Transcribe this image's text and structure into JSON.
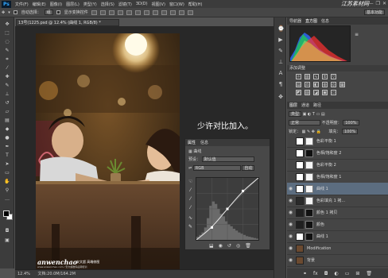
{
  "app": {
    "logo": "Ps",
    "watermark": "江苏素材网"
  },
  "menu": [
    "文件(F)",
    "编辑(E)",
    "图像(I)",
    "图层(L)",
    "类型(Y)",
    "选择(S)",
    "滤镜(T)",
    "3D(D)",
    "视图(V)",
    "窗口(W)",
    "帮助(H)"
  ],
  "window_controls": [
    "—",
    "❐",
    "✕"
  ],
  "options_bar": {
    "auto_select_label": "自动选择：",
    "auto_select_value": "组",
    "show_transform_label": "显示变换控件",
    "workspace": "基本功能"
  },
  "document": {
    "tab_title": "13号(1225.psd @ 12.4% (曲线 1, RGB/8) *",
    "caption": "少许对比加入。",
    "watermark_brand": "anwenchao",
    "watermark_cn": "安文超 高端修图",
    "watermark_sub": "www.anwenchao.com / 安文超数码后期培训"
  },
  "status_bar": {
    "zoom": "12.4%",
    "doc_info": "文档:20.0M/164.2M"
  },
  "curves_panel": {
    "tabs": [
      "属性",
      "信息"
    ],
    "title": "曲线",
    "preset_label": "预设：",
    "preset_value": "默认值",
    "channel_value": "RGB",
    "auto_button": "自动",
    "curve_points": [
      [
        0,
        0
      ],
      [
        0.25,
        0.2
      ],
      [
        0.5,
        0.5
      ],
      [
        0.75,
        0.79
      ],
      [
        1,
        1
      ]
    ],
    "histogram": [
      0.05,
      0.08,
      0.12,
      0.2,
      0.35,
      0.55,
      0.62,
      0.58,
      0.5,
      0.42,
      0.38,
      0.3,
      0.25,
      0.22,
      0.18,
      0.15,
      0.12,
      0.1,
      0.08,
      0.06,
      0.05,
      0.04,
      0.03,
      0.02
    ]
  },
  "histogram_panel": {
    "tabs": [
      "导航器",
      "直方图",
      "信息"
    ]
  },
  "adjustments_panel": {
    "title": "添加调整"
  },
  "layers_panel": {
    "tabs": [
      "图层",
      "通道",
      "路径"
    ],
    "kind_label": "类型",
    "blend_mode": "正常",
    "opacity_label": "不透明度：",
    "opacity_value": "100%",
    "lock_label": "锁定：",
    "fill_label": "填充：",
    "fill_value": "100%",
    "layers": [
      {
        "name": "色彩平衡 1",
        "thumb": "#ffffff",
        "mask": "#f4f4f4",
        "visible": false,
        "selected": false
      },
      {
        "name": "色相/饱和度 2",
        "thumb": "#ffffff",
        "mask": "#111111",
        "visible": false,
        "selected": false
      },
      {
        "name": "色彩平衡 2",
        "thumb": "#ffffff",
        "mask": "#f4f4f4",
        "visible": false,
        "selected": false
      },
      {
        "name": "色相/饱和度 1",
        "thumb": "#ffffff",
        "mask": "#f4f4f4",
        "visible": false,
        "selected": false
      },
      {
        "name": "曲线 1",
        "thumb": "#ffffff",
        "mask": "#f4f4f4",
        "visible": true,
        "selected": true
      },
      {
        "name": "色彩填充 1 拷...",
        "thumb": "#2a2a2a",
        "mask": "#f4f4f4",
        "visible": true,
        "selected": false
      },
      {
        "name": "颜色 1 拷贝",
        "thumb": "#202020",
        "mask": "#111111",
        "visible": true,
        "selected": false
      },
      {
        "name": "颜色",
        "thumb": "#202020",
        "mask": "#111111",
        "visible": true,
        "selected": false
      },
      {
        "name": "曲线 1",
        "thumb": "#ffffff",
        "mask": "#111111",
        "visible": true,
        "selected": false
      },
      {
        "name": "Modification",
        "thumb": "#6b4a30",
        "mask": "",
        "visible": true,
        "selected": false
      },
      {
        "name": "背景",
        "thumb": "#6b4a30",
        "mask": "",
        "visible": true,
        "selected": false
      }
    ]
  },
  "colors": {
    "accent": "#31a8ff",
    "selected_layer": "#5c6d80"
  }
}
